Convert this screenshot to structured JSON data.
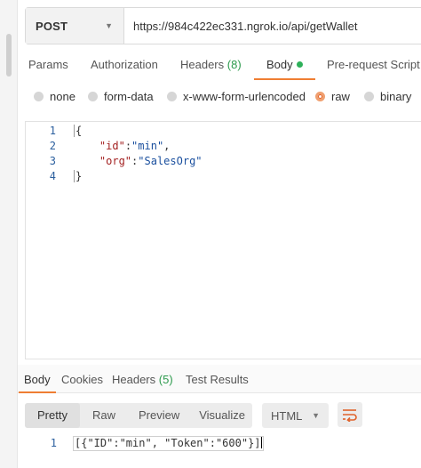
{
  "request": {
    "method": "POST",
    "url": "https://984c422ec331.ngrok.io/api/getWallet"
  },
  "request_tabs": {
    "params": "Params",
    "authorization": "Authorization",
    "headers": "Headers",
    "headers_count": "(8)",
    "body": "Body",
    "prerequest": "Pre-request Script"
  },
  "body_types": {
    "none": "none",
    "form_data": "form-data",
    "urlencoded": "x-www-form-urlencoded",
    "raw": "raw",
    "binary": "binary",
    "selected": "raw"
  },
  "editor": {
    "line_numbers": [
      "1",
      "2",
      "3",
      "4"
    ],
    "lines": {
      "open_brace": "{",
      "key1": "\"id\"",
      "val1": "\"min\"",
      "key2": "\"org\"",
      "val2": "\"SalesOrg\"",
      "close_brace": "}"
    }
  },
  "response_tabs": {
    "body": "Body",
    "cookies": "Cookies",
    "headers": "Headers",
    "headers_count": "(5)",
    "test_results": "Test Results"
  },
  "response_toolbar": {
    "pretty": "Pretty",
    "raw": "Raw",
    "preview": "Preview",
    "visualize": "Visualize",
    "format": "HTML",
    "wrap_icon": "wrap-lines-icon"
  },
  "response_body": {
    "line_number": "1",
    "text": "[{\"ID\":\"min\", \"Token\":\"600\"}]"
  },
  "colors": {
    "accent": "#ef7e33",
    "count_green": "#2e9b4e",
    "line_number": "#2b5f9e",
    "json_key": "#a32121",
    "json_string": "#1a4f9e"
  }
}
